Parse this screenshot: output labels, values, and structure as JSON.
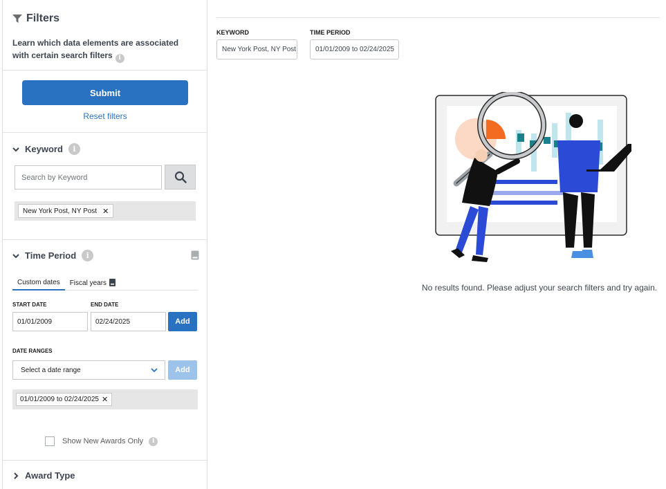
{
  "sidebar": {
    "filters": {
      "title": "Filters",
      "description": "Learn which data elements are associated with certain search filters"
    },
    "submit_label": "Submit",
    "reset_label": "Reset filters",
    "keyword": {
      "title": "Keyword",
      "placeholder": "Search by Keyword",
      "chip": "New York Post, NY Post"
    },
    "time_period": {
      "title": "Time Period",
      "tabs": [
        {
          "label": "Custom dates",
          "active": true
        },
        {
          "label": "Fiscal years",
          "active": false
        }
      ],
      "start_label": "START DATE",
      "end_label": "END DATE",
      "start_value": "01/01/2009",
      "end_value": "02/24/2025",
      "add_label": "Add",
      "ranges_label": "DATE RANGES",
      "select_placeholder": "Select a date range",
      "add_disabled_label": "Add",
      "chip": "01/01/2009 to 02/24/2025",
      "checkbox_label": "Show New Awards Only"
    },
    "award_type": {
      "title": "Award Type"
    }
  },
  "main": {
    "keyword_label": "KEYWORD",
    "keyword_value": "New York Post, NY Post",
    "time_label": "TIME PERIOD",
    "time_value": "01/01/2009 to 02/24/2025",
    "no_results": "No results found. Please adjust your search filters and try again."
  },
  "colors": {
    "primary": "#2972c2",
    "primary_disabled": "#9dc3ea",
    "illustration_blue": "#2b4bd6",
    "illustration_orange": "#f26b21",
    "illustration_teal": "#1b7f8c"
  }
}
